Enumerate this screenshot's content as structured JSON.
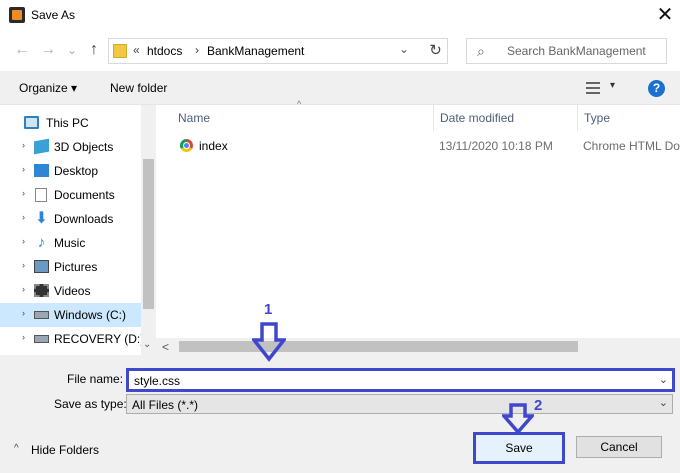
{
  "window": {
    "title": "Save As",
    "close_glyph": "✕",
    "app_icon": "sublime-text-icon"
  },
  "nav": {
    "back": "←",
    "forward": "→",
    "recent": "⌄",
    "up": "↑",
    "path_overflow": "«",
    "breadcrumbs": [
      "htdocs",
      "BankManagement"
    ],
    "separator": "›",
    "dropdown": "⌄",
    "refresh": "↻",
    "search_glyph": "⌕",
    "search_placeholder": "Search BankManagement"
  },
  "toolbar": {
    "organize": "Organize ▾",
    "new_folder": "New folder",
    "help": "?"
  },
  "tree": {
    "items": [
      {
        "label": "This PC",
        "icon": "computer-icon",
        "caret": "›",
        "selected": false
      },
      {
        "label": "3D Objects",
        "icon": "cube-icon",
        "caret": "›",
        "selected": false
      },
      {
        "label": "Desktop",
        "icon": "desktop-icon",
        "caret": "›",
        "selected": false
      },
      {
        "label": "Documents",
        "icon": "documents-icon",
        "caret": "›",
        "selected": false
      },
      {
        "label": "Downloads",
        "icon": "downloads-icon",
        "caret": "›",
        "selected": false
      },
      {
        "label": "Music",
        "icon": "music-icon",
        "caret": "›",
        "selected": false
      },
      {
        "label": "Pictures",
        "icon": "pictures-icon",
        "caret": "›",
        "selected": false
      },
      {
        "label": "Videos",
        "icon": "videos-icon",
        "caret": "›",
        "selected": false
      },
      {
        "label": "Windows (C:)",
        "icon": "drive-icon",
        "caret": "›",
        "selected": true
      },
      {
        "label": "RECOVERY (D:)",
        "icon": "drive-icon",
        "caret": "›",
        "selected": false
      }
    ],
    "scroll_down": "⌄"
  },
  "files": {
    "columns": [
      "Name",
      "Date modified",
      "Type"
    ],
    "sort_arrow": "^",
    "rows": [
      {
        "name": "index",
        "date": "13/11/2020 10:18 PM",
        "type": "Chrome HTML Do",
        "icon": "chrome-icon"
      }
    ],
    "scroll_left": "<"
  },
  "form": {
    "file_name_label": "File name:",
    "file_name_value": "style.css",
    "save_type_label": "Save as type:",
    "save_type_value": "All Files (*.*)",
    "dropdown": "⌄"
  },
  "footer": {
    "hide_caret": "^",
    "hide_folders": "Hide Folders",
    "save": "Save",
    "cancel": "Cancel"
  },
  "annotations": {
    "step1": "1",
    "step2": "2",
    "color": "#3f48cc"
  }
}
